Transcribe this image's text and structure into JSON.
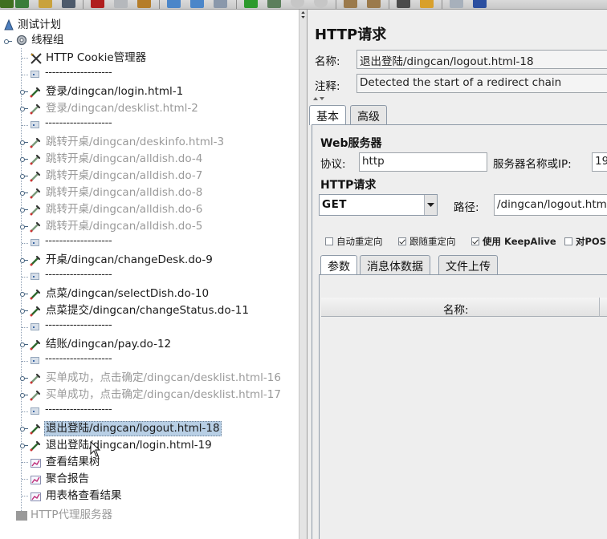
{
  "tree": {
    "root": {
      "label": "测试计划"
    },
    "thread_group": {
      "label": "线程组"
    },
    "items": [
      {
        "type": "cookie",
        "label": "HTTP Cookie管理器",
        "enabled": true
      },
      {
        "type": "separator",
        "label": "-------------------",
        "enabled": true
      },
      {
        "type": "sampler",
        "label": "登录/dingcan/login.html-1",
        "enabled": true
      },
      {
        "type": "sampler",
        "label": "登录/dingcan/desklist.html-2",
        "enabled": false
      },
      {
        "type": "separator",
        "label": "-------------------",
        "enabled": true
      },
      {
        "type": "sampler",
        "label": "跳转开桌/dingcan/deskinfo.html-3",
        "enabled": false
      },
      {
        "type": "sampler",
        "label": "跳转开桌/dingcan/alldish.do-4",
        "enabled": false
      },
      {
        "type": "sampler",
        "label": "跳转开桌/dingcan/alldish.do-7",
        "enabled": false
      },
      {
        "type": "sampler",
        "label": "跳转开桌/dingcan/alldish.do-8",
        "enabled": false
      },
      {
        "type": "sampler",
        "label": "跳转开桌/dingcan/alldish.do-6",
        "enabled": false
      },
      {
        "type": "sampler",
        "label": "跳转开桌/dingcan/alldish.do-5",
        "enabled": false
      },
      {
        "type": "separator",
        "label": "-------------------",
        "enabled": true
      },
      {
        "type": "sampler",
        "label": "开桌/dingcan/changeDesk.do-9",
        "enabled": true
      },
      {
        "type": "separator",
        "label": "-------------------",
        "enabled": true
      },
      {
        "type": "sampler",
        "label": "点菜/dingcan/selectDish.do-10",
        "enabled": true
      },
      {
        "type": "sampler",
        "label": "点菜提交/dingcan/changeStatus.do-11",
        "enabled": true
      },
      {
        "type": "separator",
        "label": "-------------------",
        "enabled": true
      },
      {
        "type": "sampler",
        "label": "结账/dingcan/pay.do-12",
        "enabled": true
      },
      {
        "type": "separator",
        "label": "-------------------",
        "enabled": true
      },
      {
        "type": "sampler",
        "label": "买单成功，点击确定/dingcan/desklist.html-16",
        "enabled": false
      },
      {
        "type": "sampler",
        "label": "买单成功，点击确定/dingcan/desklist.html-17",
        "enabled": false
      },
      {
        "type": "separator",
        "label": "-------------------",
        "enabled": true
      },
      {
        "type": "sampler",
        "label": "退出登陆/dingcan/logout.html-18",
        "enabled": true,
        "selected": true
      },
      {
        "type": "sampler",
        "label": "退出登陆/dingcan/login.html-19",
        "enabled": true
      },
      {
        "type": "listener",
        "label": "查看结果树",
        "enabled": true
      },
      {
        "type": "listener",
        "label": "聚合报告",
        "enabled": true
      },
      {
        "type": "listener",
        "label": "用表格查看结果",
        "enabled": true
      }
    ],
    "workbench_item": {
      "label": "HTTP代理服务器",
      "enabled": false
    }
  },
  "editor": {
    "title": "HTTP请求",
    "name_label": "名称:",
    "name_value": "退出登陆/dingcan/logout.html-18",
    "comment_label": "注释:",
    "comment_value": "Detected the start of a redirect chain",
    "tabs": [
      "基本",
      "高级"
    ],
    "web_server_title": "Web服务器",
    "protocol_label": "协议:",
    "protocol_value": "http",
    "server_label": "服务器名称或IP:",
    "server_value": "19",
    "http_request_title": "HTTP请求",
    "method_value": "GET",
    "path_label": "路径:",
    "path_value": "/dingcan/logout.html",
    "options": [
      {
        "label": "自动重定向",
        "checked": false
      },
      {
        "label": "跟随重定向",
        "checked": true
      },
      {
        "label": "使用 KeepAlive",
        "checked": true
      },
      {
        "label": "对POS",
        "checked": false
      }
    ],
    "param_tabs": [
      "参数",
      "消息体数据",
      "文件上传"
    ],
    "table_header_name": "名称:"
  },
  "colors": {
    "selection": "#b8cfe5",
    "disabled_text": "#9a9a9a",
    "panel_bg": "#eeeeee"
  }
}
